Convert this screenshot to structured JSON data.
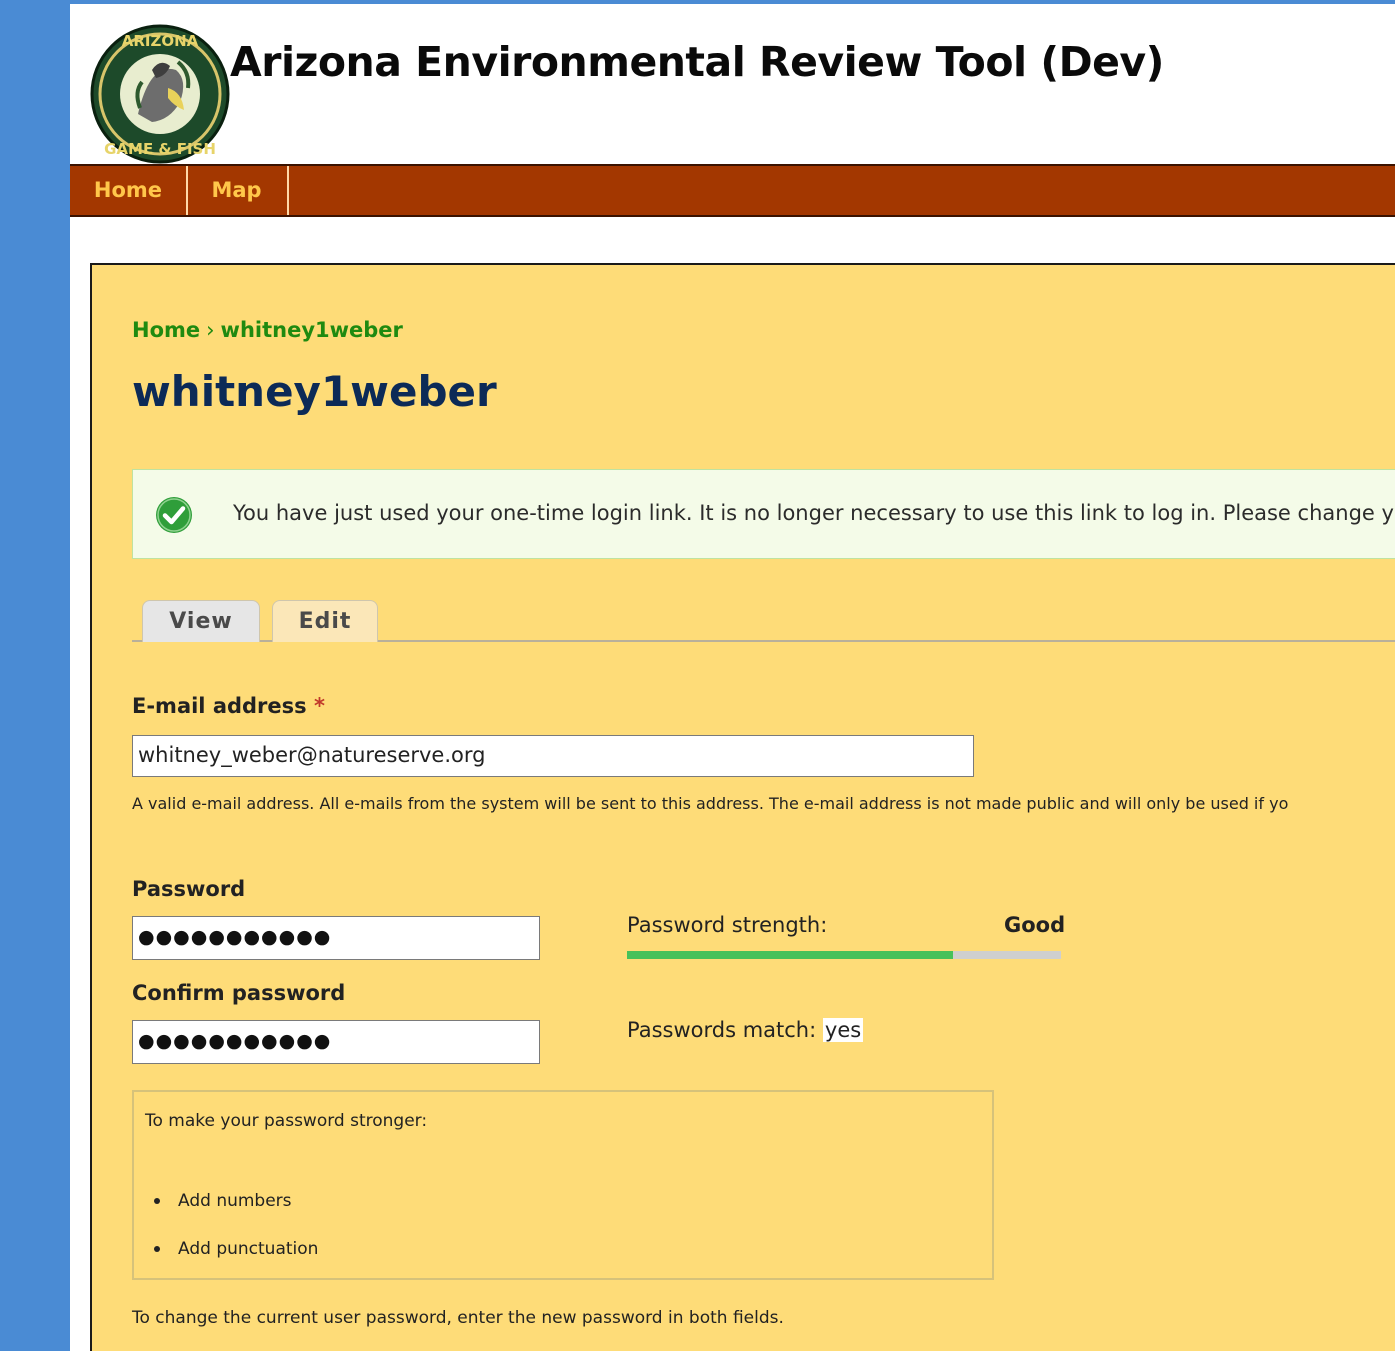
{
  "site": {
    "title": "Arizona Environmental Review Tool (Dev)",
    "logo_icon": "arizona-game-and-fish-seal",
    "logo_text": "ARIZONA GAME & FISH"
  },
  "nav": {
    "items": [
      {
        "label": "Home"
      },
      {
        "label": "Map"
      }
    ]
  },
  "breadcrumb": {
    "home": "Home",
    "separator": "›",
    "current": "whitney1weber"
  },
  "page": {
    "title": "whitney1weber"
  },
  "message": {
    "icon": "check-circle-icon",
    "text": "You have just used your one-time login link. It is no longer necessary to use this link to log in. Please change you"
  },
  "tabs": [
    {
      "label": "View"
    },
    {
      "label": "Edit"
    }
  ],
  "form": {
    "email": {
      "label": "E-mail address",
      "required_marker": "*",
      "value": "whitney_weber@natureserve.org",
      "help": "A valid e-mail address. All e-mails from the system will be sent to this address. The e-mail address is not made public and will only be used if yo"
    },
    "password": {
      "label": "Password",
      "masked_value": "●●●●●●●●●●●"
    },
    "confirm_password": {
      "label": "Confirm password",
      "masked_value": "●●●●●●●●●●●"
    },
    "strength": {
      "label": "Password strength:",
      "value": "Good",
      "level_fraction": 0.75
    },
    "match": {
      "label": "Passwords match:",
      "value": "yes"
    },
    "suggestions": {
      "title": "To make your password stronger:",
      "items": [
        "Add numbers",
        "Add punctuation"
      ]
    },
    "bottom_help": "To change the current user password, enter the new password in both fields."
  },
  "colors": {
    "frame_blue": "#4a8bd4",
    "nav_bg": "#a33700",
    "nav_text": "#ffc74a",
    "content_bg": "#fedc78",
    "breadcrumb": "#1f8a10",
    "title": "#0c2a57",
    "strength_fill": "#47c15a",
    "required": "#c0392b"
  }
}
